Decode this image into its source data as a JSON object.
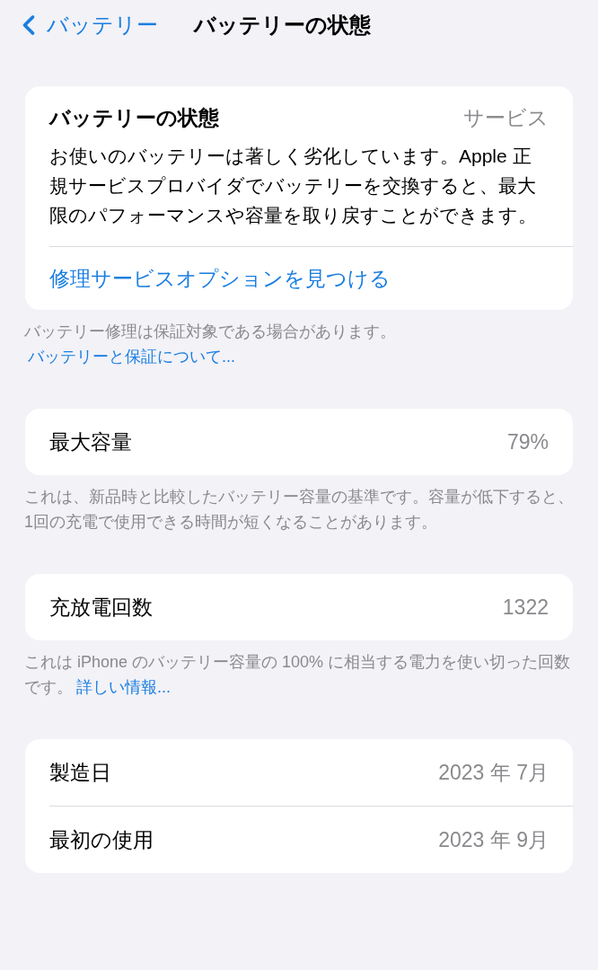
{
  "nav": {
    "back": "バッテリー",
    "title": "バッテリーの状態"
  },
  "health_card": {
    "title": "バッテリーの状態",
    "status": "サービス",
    "message": "お使いのバッテリーは著しく劣化しています。Apple 正規サービスプロバイダでバッテリーを交換すると、最大限のパフォーマンスや容量を取り戻すことができます。",
    "link": "修理サービスオプションを見つける"
  },
  "health_footer": {
    "text": "バッテリー修理は保証対象である場合があります。",
    "link": "バッテリーと保証について..."
  },
  "sections": [
    {
      "rows": [
        {
          "label": "最大容量",
          "value": "79%"
        }
      ],
      "footer": {
        "text": "これは、新品時と比較したバッテリー容量の基準です。容量が低下すると、1回の充電で使用できる時間が短くなることがあります。"
      }
    },
    {
      "rows": [
        {
          "label": "充放電回数",
          "value": "1322"
        }
      ],
      "footer": {
        "text": "これは iPhone のバッテリー容量の 100% に相当する電力を使い切った回数です。",
        "link": "詳しい情報..."
      }
    },
    {
      "rows": [
        {
          "label": "製造日",
          "value": "2023 年 7月"
        },
        {
          "label": "最初の使用",
          "value": "2023 年 9月"
        }
      ]
    }
  ]
}
